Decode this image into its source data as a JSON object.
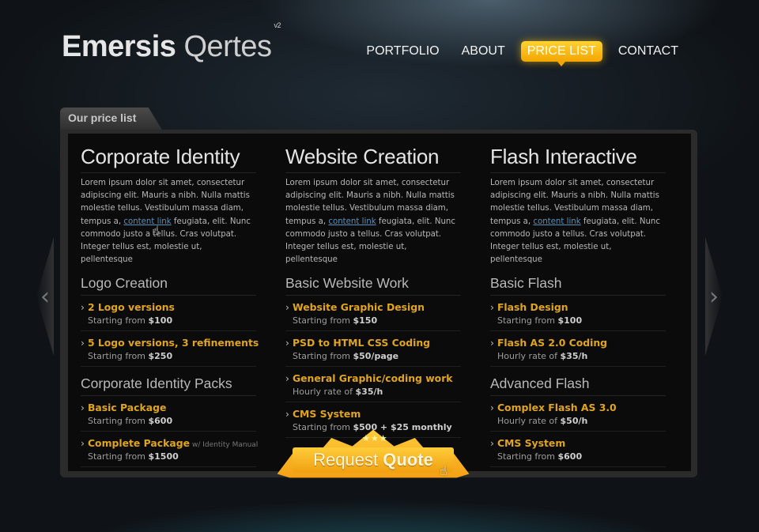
{
  "brand": {
    "name_bold": "Emersis",
    "name_light": "Qertes",
    "version": "v2"
  },
  "nav": [
    {
      "label": "PORTFOLIO"
    },
    {
      "label": "ABOUT"
    },
    {
      "label": "PRICE LIST"
    },
    {
      "label": "CONTACT"
    }
  ],
  "section_tab": "Our price list",
  "lorem": {
    "before": "Lorem ipsum dolor sit amet, consectetur adipiscing elit. Mauris a nibh. Nulla mattis molestie tellus. Vestibulum massa diam, tempus a, ",
    "link": "content link",
    "after": " feugiata, elit. Nunc commodo justo a tellus. Cras volutpat. Integer tellus est, molestie ut, pellentesque"
  },
  "columns": [
    {
      "title": "Corporate Identity",
      "groups": [
        {
          "heading": "Logo Creation",
          "items": [
            {
              "name": "2 Logo versions",
              "prefix": "Starting from",
              "price": "$100"
            },
            {
              "name": "5 Logo versions, 3 refinements",
              "prefix": "Starting from",
              "price": "$250"
            }
          ]
        },
        {
          "heading": "Corporate Identity Packs",
          "items": [
            {
              "name": "Basic Package",
              "prefix": "Starting from",
              "price": "$600"
            },
            {
              "name": "Complete Package",
              "note": "w/ Identity Manual",
              "prefix": "Starting from",
              "price": "$1500"
            }
          ]
        }
      ]
    },
    {
      "title": "Website Creation",
      "groups": [
        {
          "heading": "Basic Website Work",
          "items": [
            {
              "name": "Website Graphic Design",
              "prefix": "Starting from",
              "price": "$150"
            },
            {
              "name": "PSD to HTML CSS Coding",
              "prefix": "Starting from",
              "price": "$50/page"
            },
            {
              "name": "General Graphic/coding work",
              "prefix": "Hourly rate of",
              "price": "$35/h"
            },
            {
              "name": "CMS System",
              "prefix": "Starting from",
              "price": "$500 + $25 monthly"
            }
          ]
        }
      ]
    },
    {
      "title": "Flash Interactive",
      "groups": [
        {
          "heading": "Basic Flash",
          "items": [
            {
              "name": "Flash Design",
              "prefix": "Starting from",
              "price": "$100"
            },
            {
              "name": "Flash AS 2.0 Coding",
              "prefix": "Hourly rate of",
              "price": "$35/h"
            }
          ]
        },
        {
          "heading": "Advanced Flash",
          "items": [
            {
              "name": "Complex Flash AS 3.0",
              "prefix": "Hourly rate of",
              "price": "$50/h"
            },
            {
              "name": "CMS System",
              "prefix": "Starting from",
              "price": "$600"
            }
          ]
        }
      ]
    }
  ],
  "cta": {
    "light": "Request",
    "bold": "Quote"
  },
  "icons": {
    "prev": "chevron-left-icon",
    "next": "chevron-right-icon",
    "cursor": "hand-cursor-icon",
    "stars": "stars-icon"
  },
  "colors": {
    "accent": "#f4a500",
    "price_title": "#e0a51d",
    "link": "#5a8fb8",
    "panel": "#0b0b0b"
  }
}
